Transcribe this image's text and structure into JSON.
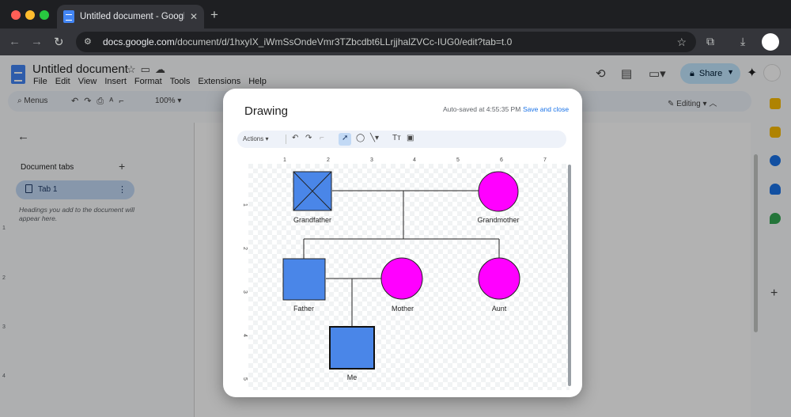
{
  "browser": {
    "tab_title": "Untitled document - Google Docs",
    "url_host": "docs.google.com",
    "url_path": "/document/d/1hxyIX_iWmSsOndeVmr3TZbcdbt6LLrjjhalZVCc-IUG0/edit?tab=t.0"
  },
  "docs": {
    "title": "Untitled document",
    "menu": [
      "File",
      "Edit",
      "View",
      "Insert",
      "Format",
      "Tools",
      "Extensions",
      "Help"
    ],
    "share_label": "Share",
    "menus_label": "Menus",
    "zoom": "100%",
    "mode": "Editing"
  },
  "sidepanel": {
    "section_label": "Document tabs",
    "tab_label": "Tab 1",
    "hint": "Headings you add to the document will appear here."
  },
  "left_ruler": [
    "1",
    "2",
    "3",
    "4"
  ],
  "dialog": {
    "title": "Drawing",
    "autosave": "Auto-saved at 4:55:35 PM",
    "save_close": "Save and close",
    "actions_label": "Actions"
  },
  "drawing": {
    "ruler_top": [
      "1",
      "2",
      "3",
      "4",
      "5",
      "6",
      "7"
    ],
    "ruler_left": [
      "1",
      "2",
      "3",
      "4",
      "5"
    ],
    "people": {
      "grandfather": "Grandfather",
      "grandmother": "Grandmother",
      "father": "Father",
      "mother": "Mother",
      "aunt": "Aunt",
      "me": "Me"
    },
    "colors": {
      "male_fill": "#4a86e8",
      "female_fill": "#ff00ff"
    }
  },
  "colors": {
    "share_bg": "#c2e7ff",
    "link_blue": "#1a73e8"
  }
}
